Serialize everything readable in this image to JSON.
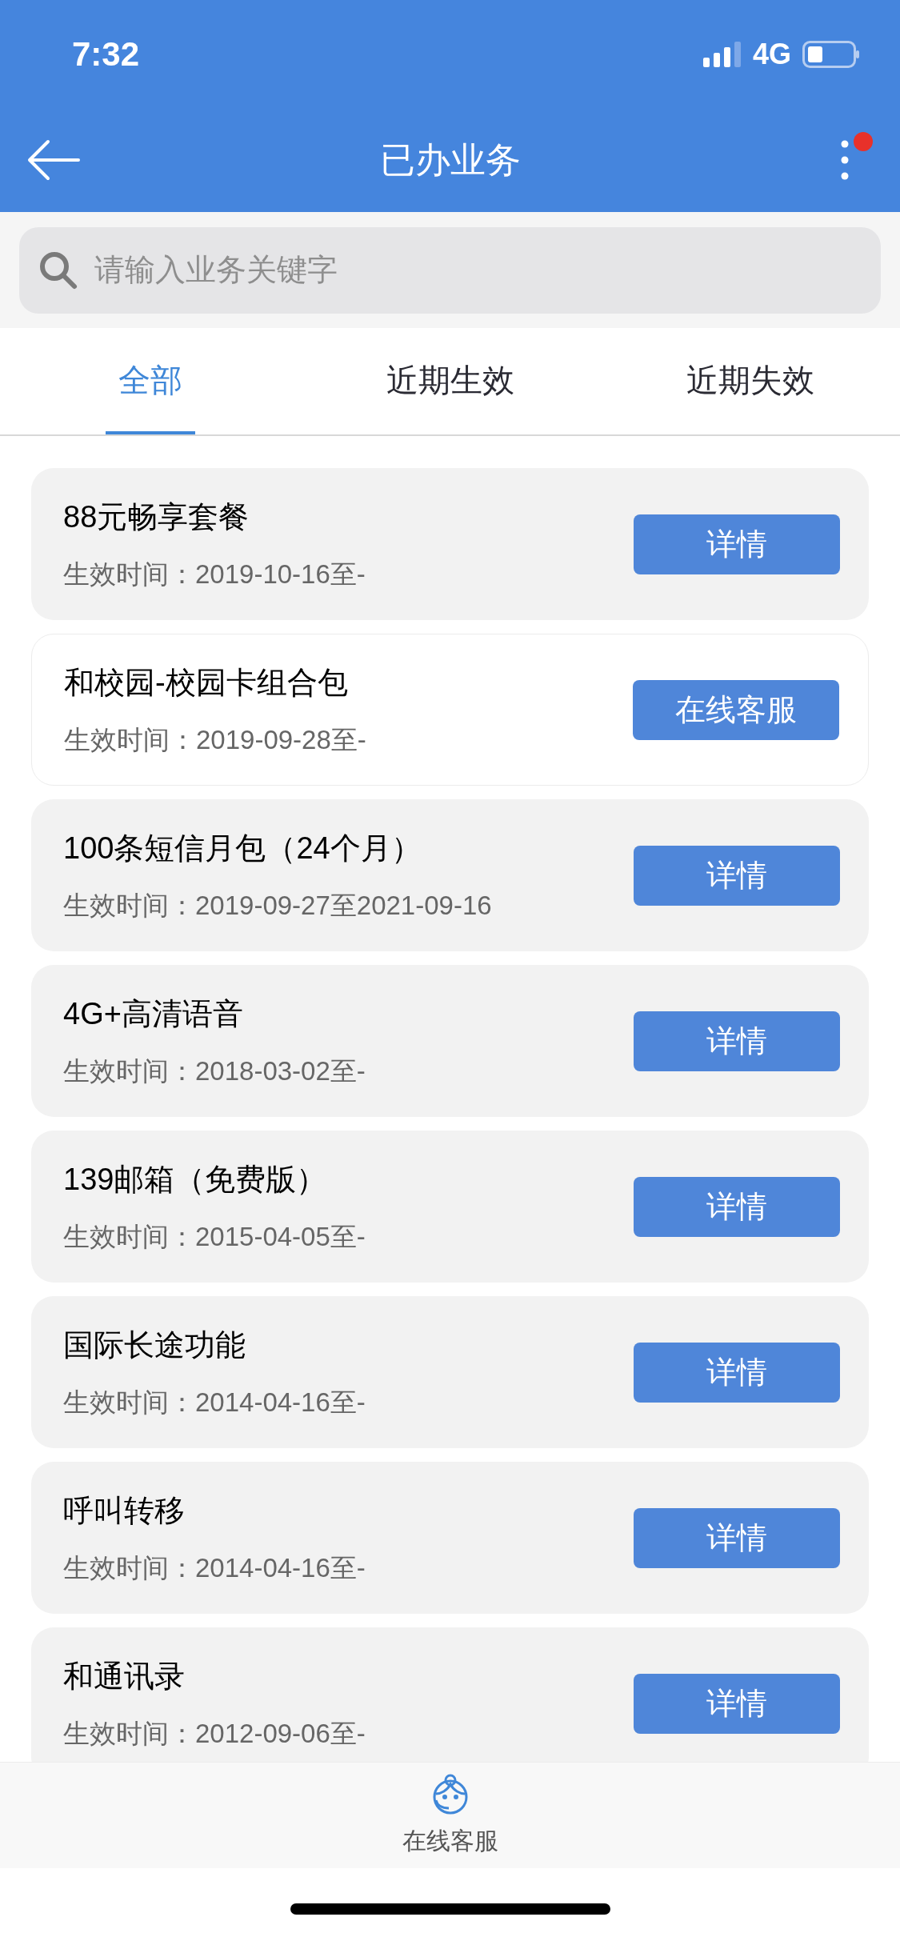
{
  "status_bar": {
    "time": "7:32",
    "network": "4G"
  },
  "nav": {
    "title": "已办业务",
    "has_notification": true
  },
  "search": {
    "placeholder": "请输入业务关键字"
  },
  "tabs": [
    {
      "label": "全部",
      "selected": true
    },
    {
      "label": "近期生效",
      "selected": false
    },
    {
      "label": "近期失效",
      "selected": false
    }
  ],
  "services": [
    {
      "name": "88元畅享套餐",
      "date": "生效时间：2019-10-16至-",
      "button": "详情",
      "kind": "shaded"
    },
    {
      "name": "和校园-校园卡组合包",
      "date": "生效时间：2019-09-28至-",
      "button": "在线客服",
      "kind": "plain"
    },
    {
      "name": "100条短信月包（24个月）",
      "date": "生效时间：2019-09-27至2021-09-16",
      "button": "详情",
      "kind": "shaded"
    },
    {
      "name": "4G+高清语音",
      "date": "生效时间：2018-03-02至-",
      "button": "详情",
      "kind": "shaded"
    },
    {
      "name": "139邮箱（免费版）",
      "date": "生效时间：2015-04-05至-",
      "button": "详情",
      "kind": "shaded"
    },
    {
      "name": "国际长途功能",
      "date": "生效时间：2014-04-16至-",
      "button": "详情",
      "kind": "shaded"
    },
    {
      "name": "呼叫转移",
      "date": "生效时间：2014-04-16至-",
      "button": "详情",
      "kind": "shaded"
    },
    {
      "name": "和通讯录",
      "date": "生效时间：2012-09-06至-",
      "button": "详情",
      "kind": "shaded"
    }
  ],
  "bottom_bar": {
    "label": "在线客服"
  }
}
